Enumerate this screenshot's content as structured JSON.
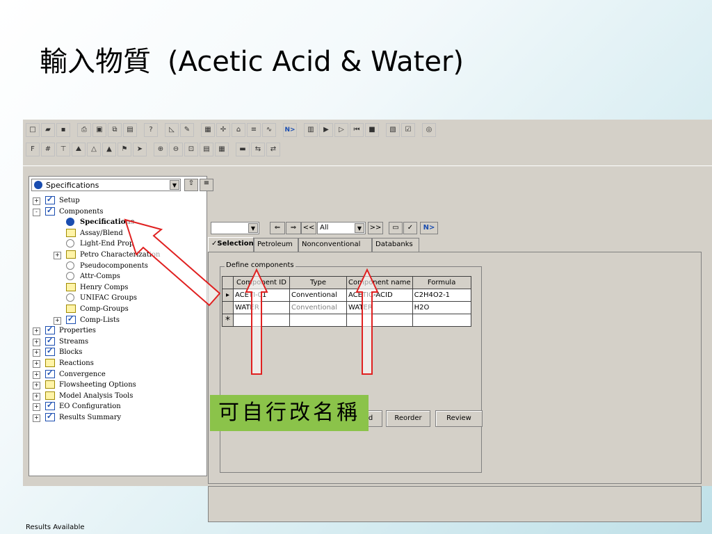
{
  "slide": {
    "title_cjk": "輸入物質",
    "title_latin": "(Acetic Acid & Water)",
    "annotation": "可自行改名稱"
  },
  "toolbar": {
    "row1_icons": [
      "new-icon",
      "open-icon",
      "save-icon",
      "print-icon",
      "print-preview-icon",
      "copy-icon",
      "paste-icon",
      "whats-this-icon",
      "flowsheet-icon",
      "pen-icon",
      "data-browser-icon",
      "model-library-icon",
      "unit-ops-icon",
      "stream-icon",
      "plot-icon",
      "next-icon",
      "control-panel-icon",
      "run-icon",
      "step-icon",
      "reinit-icon",
      "stop-icon",
      "results-icon",
      "check-icon",
      "help-icon"
    ],
    "next_label": "N>",
    "row2_icons": [
      "text-icon",
      "grid-icon",
      "align-icon",
      "mountain1-icon",
      "mountain2-icon",
      "mountain3-icon",
      "flag-icon",
      "pointer-icon",
      "zoom-in-icon",
      "zoom-out-icon",
      "zoom-full-icon",
      "layout-icon",
      "block-icon",
      "color-icon",
      "stream-move-icon",
      "stream-move2-icon"
    ]
  },
  "left_panel": {
    "combo_value": "Specifications"
  },
  "tree": [
    {
      "label": "Setup",
      "icon": "check",
      "level": 0,
      "expander": "+"
    },
    {
      "label": "Components",
      "icon": "check",
      "level": 0,
      "expander": "-"
    },
    {
      "label": "Specifications",
      "icon": "specdone",
      "level": 1,
      "bold": true
    },
    {
      "label": "Assay/Blend",
      "icon": "folder",
      "level": 1
    },
    {
      "label": "Light-End Prop",
      "icon": "circle",
      "level": 1
    },
    {
      "label": "Petro Characterization",
      "icon": "folder",
      "level": 1,
      "expander": "+"
    },
    {
      "label": "Pseudocomponents",
      "icon": "circle",
      "level": 1
    },
    {
      "label": "Attr-Comps",
      "icon": "circle",
      "level": 1
    },
    {
      "label": "Henry Comps",
      "icon": "folder",
      "level": 1
    },
    {
      "label": "UNIFAC Groups",
      "icon": "circle",
      "level": 1
    },
    {
      "label": "Comp-Groups",
      "icon": "folder",
      "level": 1
    },
    {
      "label": "Comp-Lists",
      "icon": "check",
      "level": 1,
      "expander": "+"
    },
    {
      "label": "Properties",
      "icon": "check",
      "level": 0,
      "expander": "+"
    },
    {
      "label": "Streams",
      "icon": "check",
      "level": 0,
      "expander": "+"
    },
    {
      "label": "Blocks",
      "icon": "check",
      "level": 0,
      "expander": "+"
    },
    {
      "label": "Reactions",
      "icon": "folder",
      "level": 0,
      "expander": "+"
    },
    {
      "label": "Convergence",
      "icon": "check",
      "level": 0,
      "expander": "+"
    },
    {
      "label": "Flowsheeting Options",
      "icon": "folder",
      "level": 0,
      "expander": "+"
    },
    {
      "label": "Model Analysis Tools",
      "icon": "folder",
      "level": 0,
      "expander": "+"
    },
    {
      "label": "EO Configuration",
      "icon": "check",
      "level": 0,
      "expander": "+"
    },
    {
      "label": "Results Summary",
      "icon": "check",
      "level": 0,
      "expander": "+"
    }
  ],
  "nav": {
    "prev_prev": "<<",
    "all_value": "All",
    "next_next": ">>",
    "next": "N>"
  },
  "tabs": [
    {
      "label": "✓Selection",
      "active": true
    },
    {
      "label": "Petroleum"
    },
    {
      "label": "Nonconventional"
    },
    {
      "label": "Databanks"
    }
  ],
  "groupbox_label": "Define components",
  "grid": {
    "headers": [
      "Component ID",
      "Type",
      "Component name",
      "Formula"
    ],
    "rows": [
      {
        "marker": "▸",
        "id": "ACETI-01",
        "type": "Conventional",
        "name": "ACETIC-ACID",
        "formula": "C2H4O2-1",
        "type_grey": false
      },
      {
        "marker": "",
        "id": "WATER",
        "type": "Conventional",
        "name": "WATER",
        "formula": "H2O",
        "type_grey": true
      },
      {
        "marker": "*",
        "id": "",
        "type": "",
        "name": "",
        "formula": "",
        "type_grey": false
      }
    ]
  },
  "buttons": {
    "partial": "ed",
    "reorder": "Reorder",
    "review": "Review"
  },
  "status": "Results Available"
}
